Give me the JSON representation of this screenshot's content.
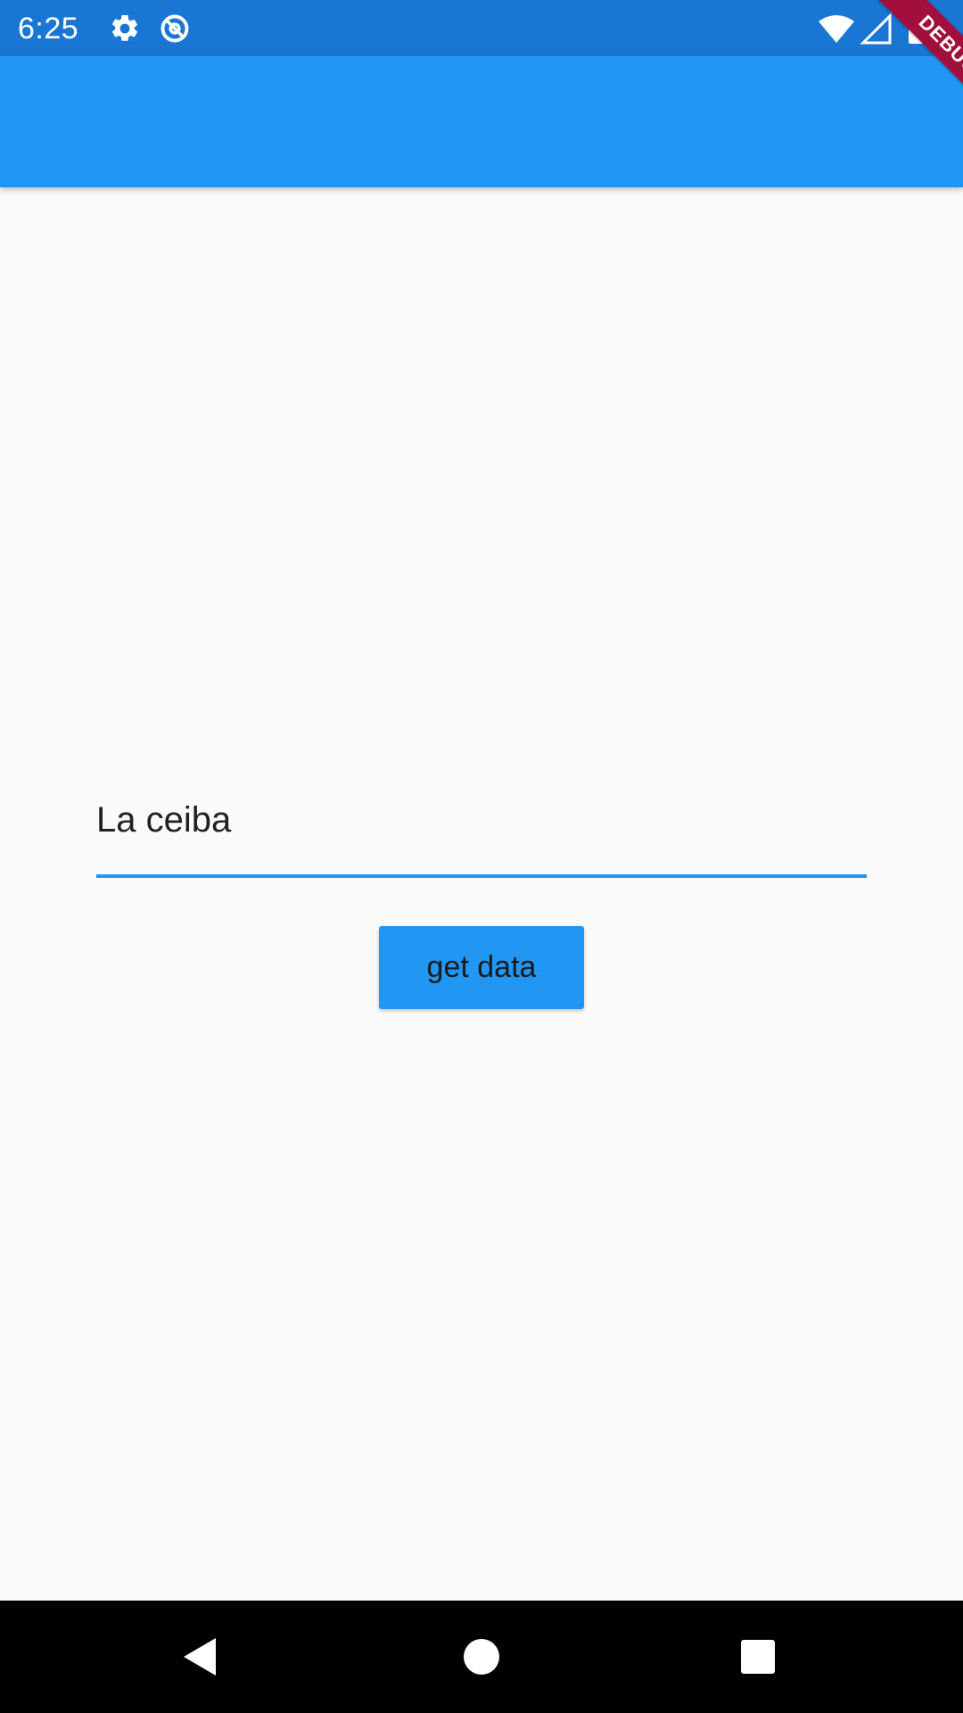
{
  "status_bar": {
    "time": "6:25",
    "icons": [
      "gear-icon",
      "sync-icon",
      "wifi-icon",
      "cell-signal-icon",
      "battery-icon"
    ],
    "color": "#1976d2"
  },
  "app_bar": {
    "title": "",
    "color": "#2196f3"
  },
  "debug_banner": {
    "label": "DEBUG",
    "color": "#a30f3c"
  },
  "form": {
    "city_input_value": "La ceiba",
    "accent_color": "#2196f3",
    "submit_label": "get data"
  },
  "nav_bar": {
    "buttons": [
      "back-icon",
      "home-icon",
      "recents-icon"
    ]
  }
}
